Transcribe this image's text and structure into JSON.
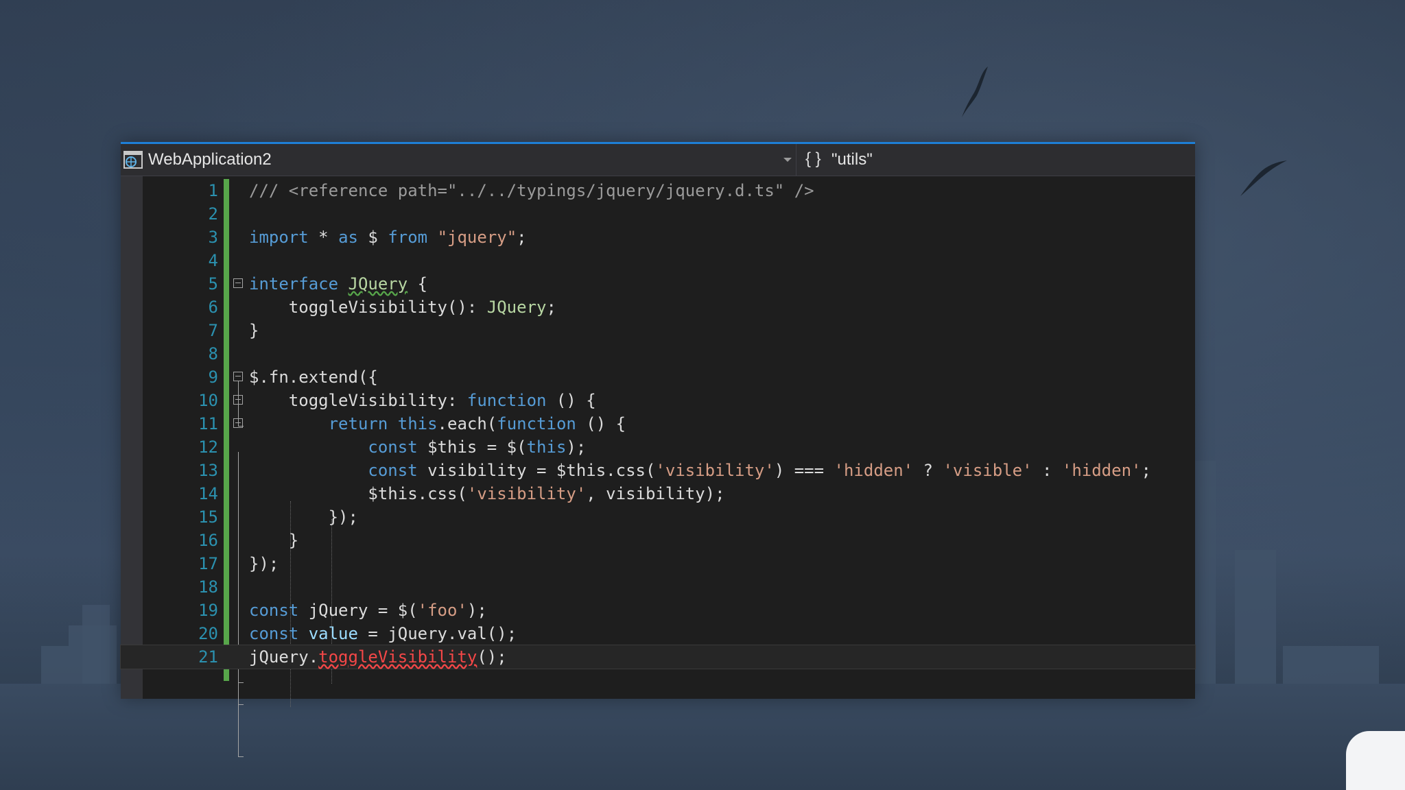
{
  "editor": {
    "project_name": "WebApplication2",
    "namespace_label": "\"utils\"",
    "namespace_icon": "{ }",
    "accent_color": "#1e7fd6"
  },
  "code_lines": [
    {
      "num": "1",
      "tokens": [
        [
          "c-gray",
          "/// <reference path=\"../../typings/jquery/jquery.d.ts\" />"
        ]
      ]
    },
    {
      "num": "2",
      "tokens": []
    },
    {
      "num": "3",
      "tokens": [
        [
          "c-kw",
          "import"
        ],
        [
          "",
          " * "
        ],
        [
          "c-kw",
          "as"
        ],
        [
          "",
          " $ "
        ],
        [
          "c-kw",
          "from"
        ],
        [
          "",
          " "
        ],
        [
          "c-str",
          "\"jquery\""
        ],
        [
          "",
          ";"
        ]
      ]
    },
    {
      "num": "4",
      "tokens": []
    },
    {
      "num": "5",
      "fold": true,
      "tokens": [
        [
          "c-kw",
          "interface"
        ],
        [
          "",
          " "
        ],
        [
          "c-type2 c-wavy",
          "JQuery"
        ],
        [
          "",
          " {"
        ]
      ]
    },
    {
      "num": "6",
      "tokens": [
        [
          "",
          "    toggleVisibility(): "
        ],
        [
          "c-type2",
          "JQuery"
        ],
        [
          "",
          ";"
        ]
      ]
    },
    {
      "num": "7",
      "tokens": [
        [
          "",
          "}"
        ]
      ]
    },
    {
      "num": "8",
      "tokens": []
    },
    {
      "num": "9",
      "fold": true,
      "tokens": [
        [
          "",
          "$.fn.extend({"
        ]
      ]
    },
    {
      "num": "10",
      "fold": true,
      "tokens": [
        [
          "",
          "    toggleVisibility: "
        ],
        [
          "c-kw",
          "function"
        ],
        [
          "",
          " () {"
        ]
      ]
    },
    {
      "num": "11",
      "fold": true,
      "tokens": [
        [
          "",
          "        "
        ],
        [
          "c-kw",
          "return"
        ],
        [
          "",
          " "
        ],
        [
          "c-kw",
          "this"
        ],
        [
          "",
          ".each("
        ],
        [
          "c-kw",
          "function"
        ],
        [
          "",
          " () {"
        ]
      ]
    },
    {
      "num": "12",
      "tokens": [
        [
          "",
          "            "
        ],
        [
          "c-kw",
          "const"
        ],
        [
          "",
          " $this = $("
        ],
        [
          "c-kw",
          "this"
        ],
        [
          "",
          ");"
        ]
      ]
    },
    {
      "num": "13",
      "tokens": [
        [
          "",
          "            "
        ],
        [
          "c-kw",
          "const"
        ],
        [
          "",
          " visibility = $this.css("
        ],
        [
          "c-str",
          "'visibility'"
        ],
        [
          "",
          ") === "
        ],
        [
          "c-str",
          "'hidden'"
        ],
        [
          "",
          " ? "
        ],
        [
          "c-str",
          "'visible'"
        ],
        [
          "",
          " : "
        ],
        [
          "c-str",
          "'hidden'"
        ],
        [
          "",
          ";"
        ]
      ]
    },
    {
      "num": "14",
      "tokens": [
        [
          "",
          "            $this.css("
        ],
        [
          "c-str",
          "'visibility'"
        ],
        [
          "",
          ", visibility);"
        ]
      ]
    },
    {
      "num": "15",
      "tokens": [
        [
          "",
          "        });"
        ]
      ]
    },
    {
      "num": "16",
      "tokens": [
        [
          "",
          "    }"
        ]
      ]
    },
    {
      "num": "17",
      "tokens": [
        [
          "",
          "});"
        ]
      ]
    },
    {
      "num": "18",
      "tokens": []
    },
    {
      "num": "19",
      "tokens": [
        [
          "c-kw",
          "const"
        ],
        [
          "",
          " jQuery = $("
        ],
        [
          "c-str",
          "'foo'"
        ],
        [
          "",
          ");"
        ]
      ]
    },
    {
      "num": "20",
      "tokens": [
        [
          "c-kw",
          "const"
        ],
        [
          "",
          " "
        ],
        [
          "c-var",
          "value"
        ],
        [
          "",
          " = jQuery.val();"
        ]
      ]
    },
    {
      "num": "21",
      "current": true,
      "tokens": [
        [
          "",
          "jQuery."
        ],
        [
          "c-err",
          "toggleVisibility"
        ],
        [
          "",
          "();"
        ]
      ]
    }
  ]
}
